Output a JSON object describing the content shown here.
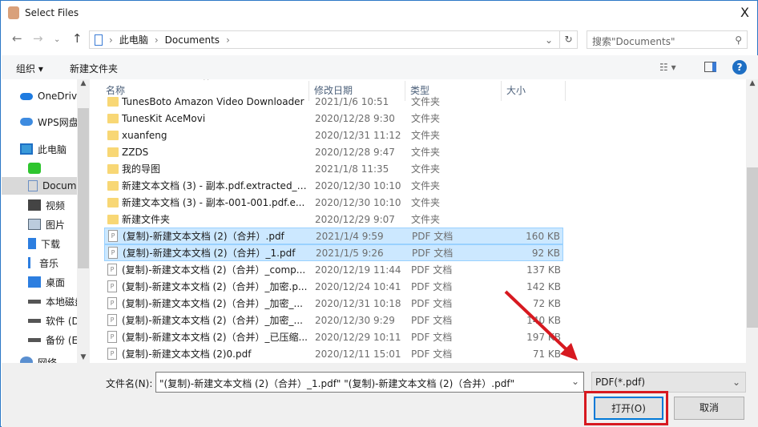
{
  "window": {
    "title": "Select Files",
    "close": "X"
  },
  "address": {
    "crumbs": [
      "此电脑",
      "Documents"
    ],
    "search_placeholder": "搜索\"Documents\""
  },
  "toolbar": {
    "organize": "组织 ▾",
    "new_folder": "新建文件夹"
  },
  "sidebar": {
    "items": [
      {
        "label": "OneDrive",
        "icon": "onedrive-icon"
      },
      {
        "label": "WPS网盘",
        "icon": "cloud-icon"
      },
      {
        "label": "此电脑",
        "icon": "computer-icon"
      },
      {
        "label": "",
        "icon": "app-icon"
      },
      {
        "label": "Documents",
        "icon": "document-icon"
      },
      {
        "label": "视频",
        "icon": "video-icon"
      },
      {
        "label": "图片",
        "icon": "picture-icon"
      },
      {
        "label": "下载",
        "icon": "download-icon"
      },
      {
        "label": "音乐",
        "icon": "music-icon"
      },
      {
        "label": "桌面",
        "icon": "desktop-icon"
      },
      {
        "label": "本地磁盘",
        "icon": "drive-icon"
      },
      {
        "label": "软件 (D:)",
        "icon": "drive-icon"
      },
      {
        "label": "备份 (E:)",
        "icon": "drive-icon"
      },
      {
        "label": "网络",
        "icon": "network-icon"
      }
    ]
  },
  "columns": {
    "name": "名称",
    "date": "修改日期",
    "type": "类型",
    "size": "大小"
  },
  "files": [
    {
      "name": "TunesBoto Amazon Video Downloader",
      "date": "2021/1/6 10:51",
      "type": "文件夹",
      "size": "",
      "kind": "folder"
    },
    {
      "name": "TunesKit AceMovi",
      "date": "2020/12/28 9:30",
      "type": "文件夹",
      "size": "",
      "kind": "folder"
    },
    {
      "name": "xuanfeng",
      "date": "2020/12/31 11:12",
      "type": "文件夹",
      "size": "",
      "kind": "folder"
    },
    {
      "name": "ZZDS",
      "date": "2020/12/28 9:47",
      "type": "文件夹",
      "size": "",
      "kind": "folder"
    },
    {
      "name": "我的导图",
      "date": "2021/1/8 11:35",
      "type": "文件夹",
      "size": "",
      "kind": "folder"
    },
    {
      "name": "新建文本文档 (3) - 副本.pdf.extracted_i...",
      "date": "2020/12/30 10:10",
      "type": "文件夹",
      "size": "",
      "kind": "folder"
    },
    {
      "name": "新建文本文档 (3) - 副本-001-001.pdf.e...",
      "date": "2020/12/30 10:10",
      "type": "文件夹",
      "size": "",
      "kind": "folder"
    },
    {
      "name": "新建文件夹",
      "date": "2020/12/29 9:07",
      "type": "文件夹",
      "size": "",
      "kind": "folder"
    },
    {
      "name": "(复制)-新建文本文档 (2)（合并）.pdf",
      "date": "2021/1/4 9:59",
      "type": "PDF 文档",
      "size": "160 KB",
      "kind": "pdf",
      "selected": true
    },
    {
      "name": "(复制)-新建文本文档 (2)（合并）_1.pdf",
      "date": "2021/1/5 9:26",
      "type": "PDF 文档",
      "size": "92 KB",
      "kind": "pdf",
      "selected": true
    },
    {
      "name": "(复制)-新建文本文档 (2)（合并）_comp...",
      "date": "2020/12/19 11:44",
      "type": "PDF 文档",
      "size": "137 KB",
      "kind": "pdf"
    },
    {
      "name": "(复制)-新建文本文档 (2)（合并）_加密.p...",
      "date": "2020/12/24 10:41",
      "type": "PDF 文档",
      "size": "142 KB",
      "kind": "pdf"
    },
    {
      "name": "(复制)-新建文本文档 (2)（合并）_加密_...",
      "date": "2020/12/31 10:18",
      "type": "PDF 文档",
      "size": "72 KB",
      "kind": "pdf"
    },
    {
      "name": "(复制)-新建文本文档 (2)（合并）_加密_...",
      "date": "2020/12/30 9:29",
      "type": "PDF 文档",
      "size": "140 KB",
      "kind": "pdf"
    },
    {
      "name": "(复制)-新建文本文档 (2)（合并）_已压缩...",
      "date": "2020/12/29 10:11",
      "type": "PDF 文档",
      "size": "197 KB",
      "kind": "pdf"
    },
    {
      "name": "(复制)-新建文本文档 (2)0.pdf",
      "date": "2020/12/11 15:01",
      "type": "PDF 文档",
      "size": "71 KB",
      "kind": "pdf"
    }
  ],
  "bottom": {
    "filename_label": "文件名(N):",
    "filename_value": "\"(复制)-新建文本文档 (2)（合并）_1.pdf\" \"(复制)-新建文本文档 (2)（合并）.pdf\"",
    "filter": "PDF(*.pdf)",
    "open": "打开(O)",
    "cancel": "取消"
  },
  "colors": {
    "selection": "#cce8ff",
    "highlight": "#d71920"
  }
}
